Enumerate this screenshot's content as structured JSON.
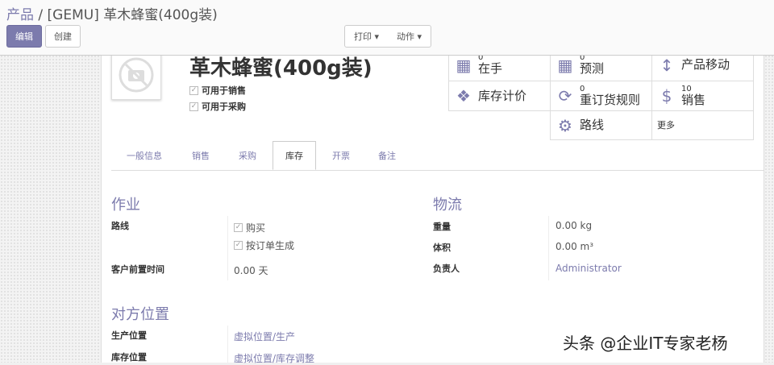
{
  "breadcrumb": {
    "parent": "产品",
    "current": "[GEMU] 革木蜂蜜(400g装)"
  },
  "buttons": {
    "edit": "编辑",
    "create": "创建",
    "print": "打印",
    "action": "动作"
  },
  "product": {
    "name": "革木蜂蜜(400g装)",
    "can_be_sold": "可用于销售",
    "can_be_purchased": "可用于采购"
  },
  "stats": [
    {
      "icon": "building-icon",
      "count": "0",
      "label": "在手"
    },
    {
      "icon": "building-icon",
      "count": "0",
      "label": "预测"
    },
    {
      "icon": "arrows-vertical-icon",
      "count": "",
      "label": "产品移动"
    },
    {
      "icon": "cubes-icon",
      "count": "",
      "label": "库存计价"
    },
    {
      "icon": "refresh-icon",
      "count": "0",
      "label": "重订货规则"
    },
    {
      "icon": "dollar-icon",
      "count": "10",
      "label": "销售"
    },
    {
      "icon": "cogs-icon",
      "count": "",
      "label": "路线"
    },
    {
      "icon": "",
      "count": "",
      "label": "更多"
    }
  ],
  "tabs": [
    "一般信息",
    "销售",
    "采购",
    "库存",
    "开票",
    "备注"
  ],
  "active_tab": "库存",
  "operations": {
    "title": "作业",
    "routes_label": "路线",
    "route1": "购买",
    "route2": "按订单生成",
    "lead_label": "客户前置时间",
    "lead_value": "0.00 天"
  },
  "logistics": {
    "title": "物流",
    "weight_label": "重量",
    "weight": "0.00 kg",
    "volume_label": "体积",
    "volume": "0.00 m³",
    "responsible_label": "负责人",
    "responsible": "Administrator"
  },
  "counterpart": {
    "title": "对方位置",
    "production_label": "生产位置",
    "production": "虚拟位置/生产",
    "inventory_label": "库存位置",
    "inventory": "虚拟位置/库存调整"
  },
  "watermark": "头条 @企业IT专家老杨"
}
